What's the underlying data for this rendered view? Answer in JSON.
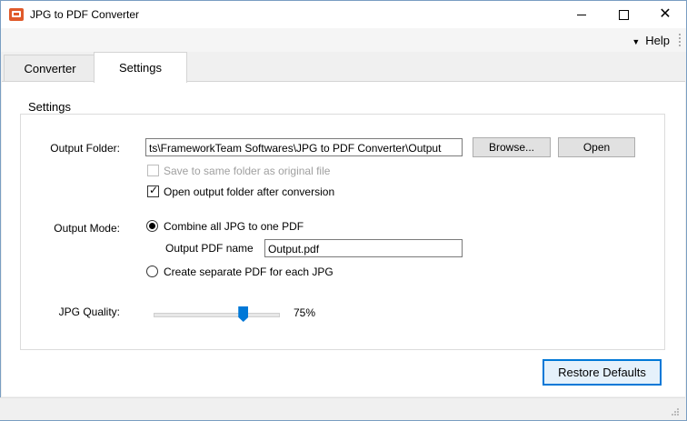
{
  "window": {
    "title": "JPG to PDF Converter"
  },
  "menu": {
    "help_label": "Help"
  },
  "tabs": [
    {
      "label": "Converter",
      "active": false
    },
    {
      "label": "Settings",
      "active": true
    }
  ],
  "settings": {
    "group_title": "Settings",
    "output_folder": {
      "label": "Output Folder:",
      "value": "ts\\FrameworkTeam Softwares\\JPG to PDF Converter\\Output",
      "browse_label": "Browse...",
      "open_label": "Open"
    },
    "save_same_folder": {
      "label": "Save to same folder as original file",
      "checked": false,
      "enabled": false
    },
    "open_after": {
      "label": "Open output folder after conversion",
      "checked": true,
      "enabled": true
    },
    "output_mode": {
      "label": "Output Mode:",
      "combine_label": "Combine all JPG to one PDF",
      "combine_selected": true,
      "pdf_name_label": "Output PDF name",
      "pdf_name_value": "Output.pdf",
      "separate_label": "Create separate PDF for each JPG",
      "separate_selected": false
    },
    "jpg_quality": {
      "label": "JPG Quality:",
      "value_text": "75%",
      "value": 75
    }
  },
  "footer": {
    "restore_label": "Restore Defaults"
  },
  "colors": {
    "accent": "#0078d7",
    "app_icon": "#e05a2a"
  },
  "icons": {
    "app": "app-icon",
    "minimize": "minimize-icon",
    "maximize": "maximize-icon",
    "close": "close-icon",
    "help_dropdown": "chevron-down-icon"
  }
}
